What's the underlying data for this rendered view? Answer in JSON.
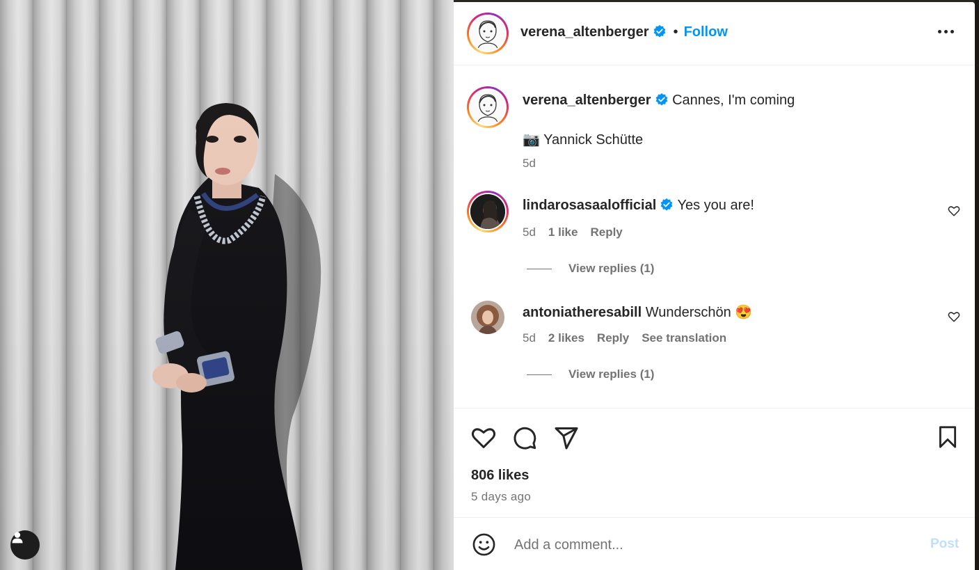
{
  "post": {
    "author": "verena_altenberger",
    "follow_label": "Follow",
    "caption_text": "Cannes, I'm coming",
    "credit_emoji": "📷",
    "credit_name": "Yannick Schütte",
    "caption_age": "5d",
    "likes": "806 likes",
    "posted_ago": "5 days ago"
  },
  "comments": [
    {
      "user": "lindarosasaalofficial",
      "verified": true,
      "text": "Yes you are!",
      "age": "5d",
      "likes": "1 like",
      "reply": "Reply",
      "view_replies": "View replies (1)"
    },
    {
      "user": "antoniatheresabill",
      "verified": false,
      "text": "Wunderschön 😍",
      "age": "5d",
      "likes": "2 likes",
      "reply": "Reply",
      "see_translation": "See translation",
      "view_replies": "View replies (1)"
    }
  ],
  "composer": {
    "placeholder": "Add a comment...",
    "post_label": "Post"
  },
  "icons": [
    "verified-badge-icon",
    "more-options-icon",
    "heart-icon",
    "comment-icon",
    "share-icon",
    "save-icon",
    "emoji-icon",
    "user-icon"
  ],
  "colors": {
    "accent": "#0095f6",
    "text": "#262626",
    "muted": "#737373",
    "post_disabled": "#c0dffd"
  }
}
